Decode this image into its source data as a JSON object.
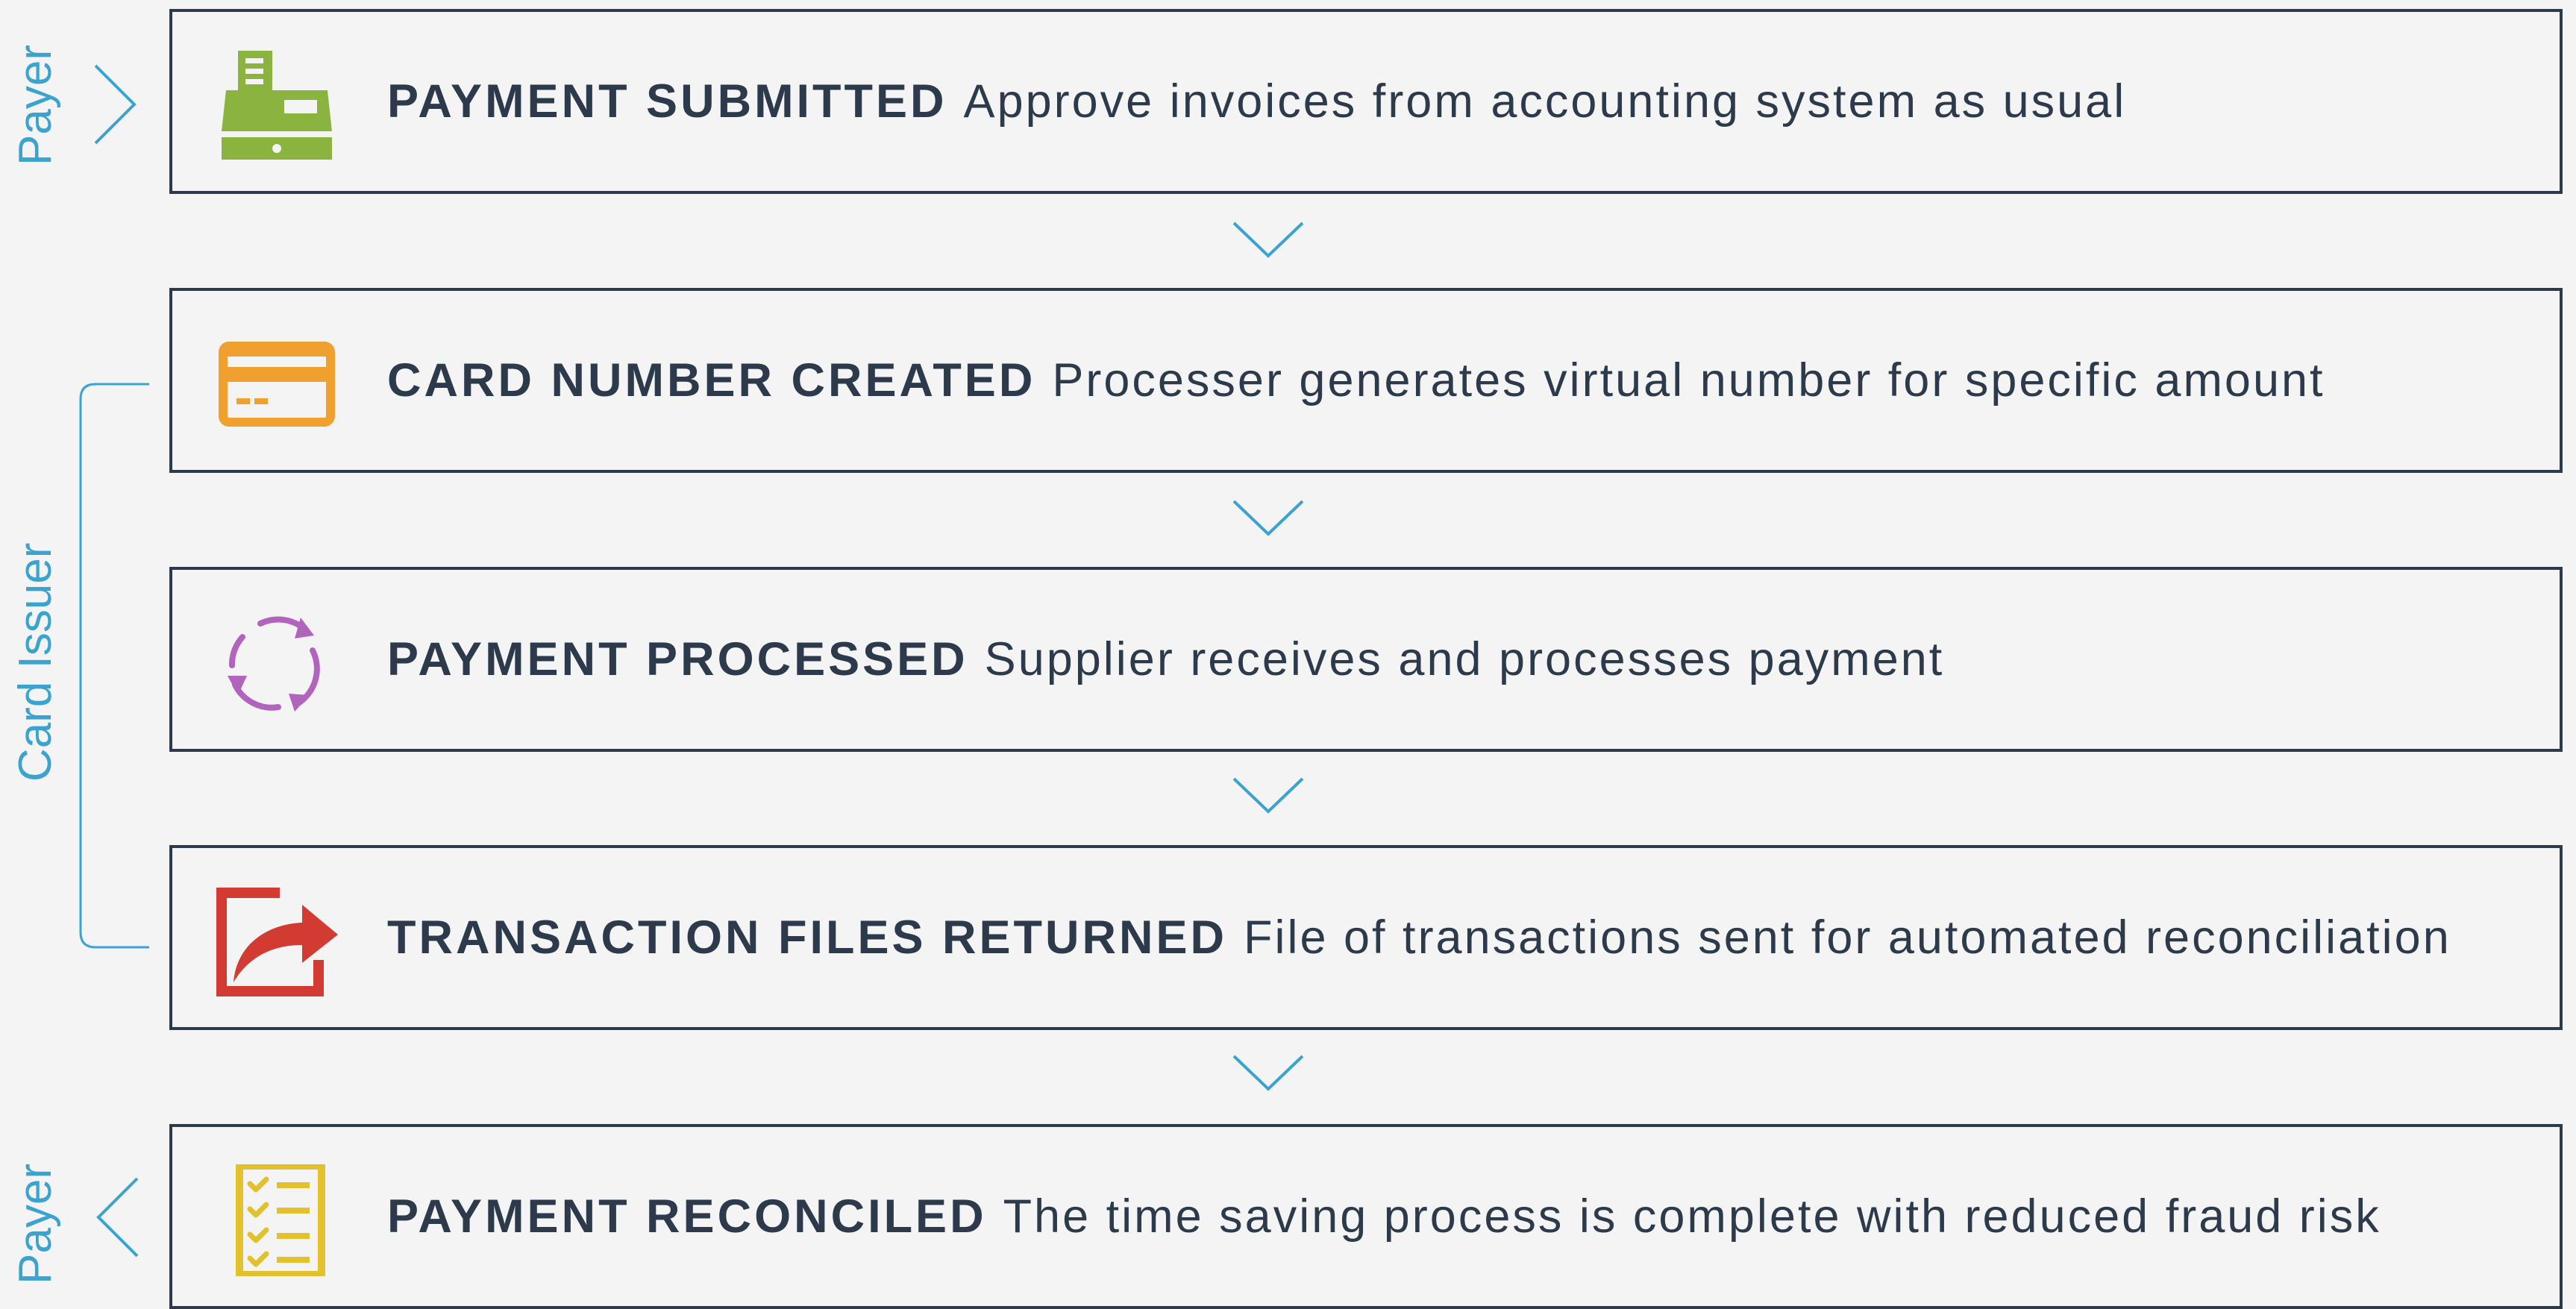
{
  "colors": {
    "border": "#2c3a4b",
    "text": "#2c3a4b",
    "accent_blue": "#3ba3cf",
    "green": "#8ab33f",
    "orange": "#efa02f",
    "purple": "#b163bd",
    "red": "#d13b31",
    "yellow": "#e2c12c",
    "background": "#f4f4f4"
  },
  "side_labels": {
    "top": "Payer",
    "middle": "Card Issuer",
    "bottom": "Payer"
  },
  "steps": [
    {
      "title": "PAYMENT SUBMITTED",
      "description": "Approve invoices from accounting system as usual",
      "icon": "cash-register-icon"
    },
    {
      "title": "CARD NUMBER CREATED",
      "description": "Processer generates virtual number for specific amount",
      "icon": "credit-card-icon"
    },
    {
      "title": "PAYMENT PROCESSED",
      "description": "Supplier receives and processes payment",
      "icon": "refresh-cycle-icon"
    },
    {
      "title": "TRANSACTION FILES RETURNED",
      "description": "File of transactions sent for automated reconciliation",
      "icon": "share-export-icon"
    },
    {
      "title": "PAYMENT RECONCILED",
      "description": "The time saving process is complete with reduced fraud risk",
      "icon": "checklist-icon"
    }
  ]
}
